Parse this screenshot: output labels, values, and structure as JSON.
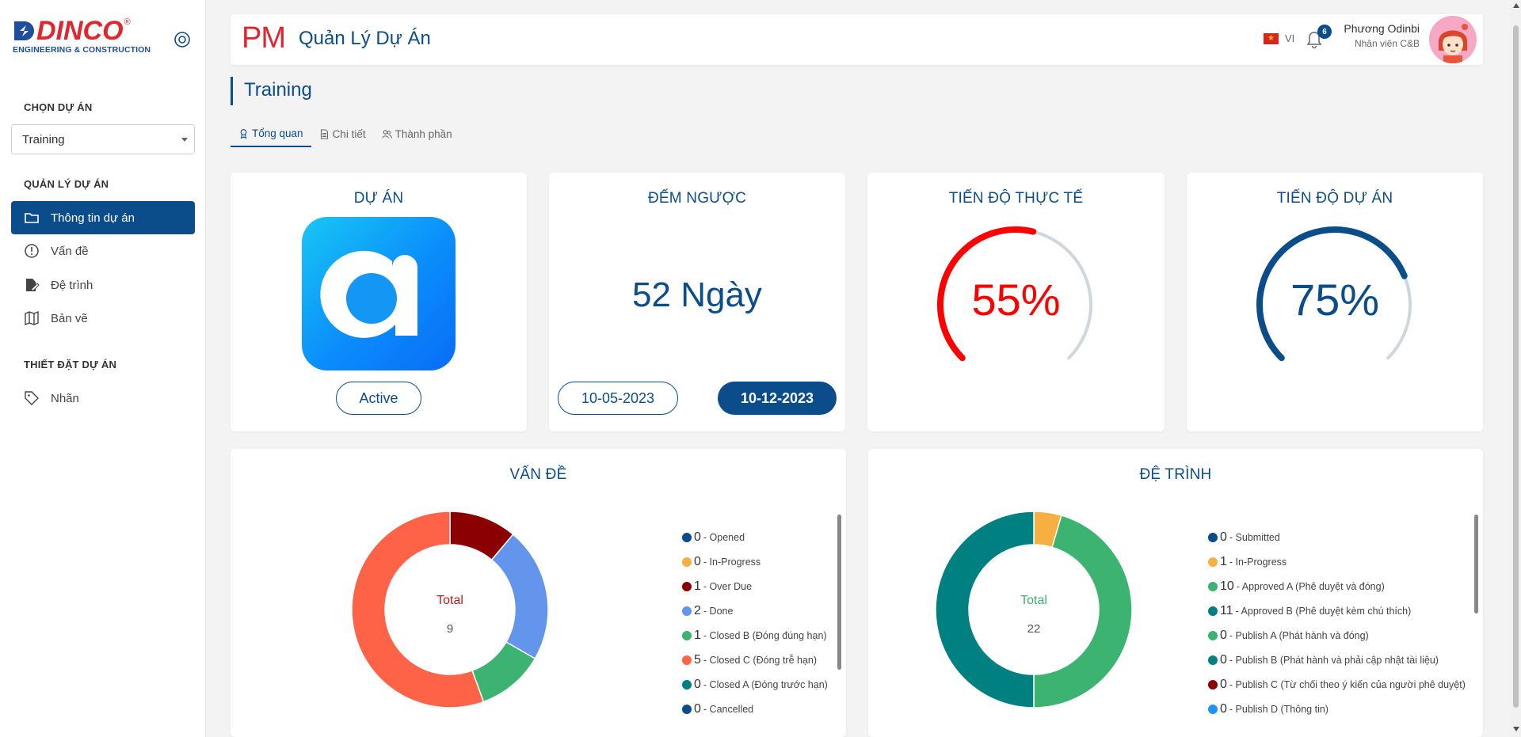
{
  "brand": {
    "logo_text": "DINCO",
    "logo_reg": "®",
    "logo_sub": "ENGINEERING & CONSTRUCTION"
  },
  "sidebar": {
    "choose_project_title": "CHỌN DỰ ÁN",
    "project_select": {
      "value": "Training"
    },
    "manage_title": "QUẢN LÝ DỰ ÁN",
    "manage_items": [
      {
        "label": "Thông tin dự án",
        "icon": "folder-icon",
        "active": true
      },
      {
        "label": "Vấn đề",
        "icon": "alert-circle-icon"
      },
      {
        "label": "Đệ trình",
        "icon": "file-edit-icon"
      },
      {
        "label": "Bản vẽ",
        "icon": "map-icon"
      }
    ],
    "settings_title": "THIẾT ĐẶT DỰ ÁN",
    "settings_items": [
      {
        "label": "Nhãn",
        "icon": "tag-icon"
      }
    ]
  },
  "header": {
    "pm": "PM",
    "title": "Quản Lý Dự Án",
    "language": "VI",
    "notification_count": "6",
    "user_name": "Phương Odinbi",
    "user_role": "Nhân viên C&B"
  },
  "page": {
    "title": "Training",
    "tabs": [
      {
        "label": "Tổng quan",
        "icon": "award-icon",
        "active": true
      },
      {
        "label": "Chi tiết",
        "icon": "document-icon"
      },
      {
        "label": "Thành phần",
        "icon": "users-icon"
      }
    ]
  },
  "cards": {
    "project": {
      "title": "DỰ ÁN",
      "status": "Active"
    },
    "countdown": {
      "title": "ĐẾM NGƯỢC",
      "value": "52 Ngày",
      "start_date": "10-05-2023",
      "end_date": "10-12-2023"
    },
    "actual_progress": {
      "title": "TIẾN ĐỘ THỰC TẾ",
      "value_text": "55%",
      "fraction": 0.55,
      "color": "#ff0000"
    },
    "project_progress": {
      "title": "TIẾN ĐỘ DỰ ÁN",
      "value_text": "75%",
      "fraction": 0.75,
      "color": "#0b4d8a"
    }
  },
  "colors": {
    "primary": "#0b4d8a",
    "accent_red": "#e0262e",
    "track": "#cfd6dc"
  },
  "chart_data": [
    {
      "type": "pie",
      "title": "VẤN ĐỀ",
      "center_label": "Total",
      "total": "9",
      "center_color": "#b71c1c",
      "slices": [
        {
          "value": "0",
          "label": "- Opened",
          "color": "#0b4d8a"
        },
        {
          "value": "0",
          "label": "- In-Progress",
          "color": "#f5b041"
        },
        {
          "value": "1",
          "label": "- Over Due",
          "color": "#8b0000"
        },
        {
          "value": "2",
          "label": "- Done",
          "color": "#6495ed"
        },
        {
          "value": "1",
          "label": "- Closed B (Đóng đúng hạn)",
          "color": "#3cb371"
        },
        {
          "value": "5",
          "label": "- Closed C (Đóng trễ hạn)",
          "color": "#ff6347"
        },
        {
          "value": "0",
          "label": "- Closed A (Đóng trước hạn)",
          "color": "#008080"
        },
        {
          "value": "0",
          "label": "- Cancelled",
          "color": "#0b4d8a"
        }
      ]
    },
    {
      "type": "pie",
      "title": "ĐỆ TRÌNH",
      "center_label": "Total",
      "total": "22",
      "center_color": "#3cb371",
      "slices": [
        {
          "value": "0",
          "label": "- Submitted",
          "color": "#0b4d8a"
        },
        {
          "value": "1",
          "label": "- In-Progress",
          "color": "#f5b041"
        },
        {
          "value": "10",
          "label": "- Approved A (Phê duyệt và đóng)",
          "color": "#3cb371"
        },
        {
          "value": "11",
          "label": "- Approved B (Phê duyệt kèm chú thích)",
          "color": "#008080"
        },
        {
          "value": "0",
          "label": "- Publish A (Phát hành và đóng)",
          "color": "#3cb371"
        },
        {
          "value": "0",
          "label": "- Publish B (Phát hành và phải cập nhật tài liệu)",
          "color": "#008080"
        },
        {
          "value": "0",
          "label": "- Publish C (Từ chối theo ý kiến của người phê duyệt)",
          "color": "#8b0000"
        },
        {
          "value": "0",
          "label": "- Publish D (Thông tin)",
          "color": "#1e90ff"
        }
      ]
    }
  ]
}
